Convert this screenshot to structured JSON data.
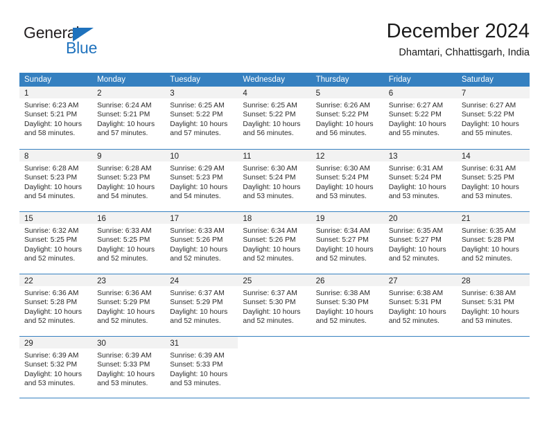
{
  "brand": {
    "name_part1": "General",
    "name_part2": "Blue",
    "accent_color": "#1f72bd"
  },
  "header": {
    "title": "December 2024",
    "location": "Dhamtari, Chhattisgarh, India"
  },
  "theme": {
    "header_band": "#3580c0",
    "day_number_band": "#f2f2f2",
    "grid_line": "#3580c0"
  },
  "calendar": {
    "weekday_headers": [
      "Sunday",
      "Monday",
      "Tuesday",
      "Wednesday",
      "Thursday",
      "Friday",
      "Saturday"
    ],
    "labels": {
      "sunrise": "Sunrise:",
      "sunset": "Sunset:",
      "daylight": "Daylight:"
    },
    "weeks": [
      [
        {
          "day": "1",
          "sunrise": "Sunrise: 6:23 AM",
          "sunset": "Sunset: 5:21 PM",
          "daylight_line1": "Daylight: 10 hours",
          "daylight_line2": "and 58 minutes."
        },
        {
          "day": "2",
          "sunrise": "Sunrise: 6:24 AM",
          "sunset": "Sunset: 5:21 PM",
          "daylight_line1": "Daylight: 10 hours",
          "daylight_line2": "and 57 minutes."
        },
        {
          "day": "3",
          "sunrise": "Sunrise: 6:25 AM",
          "sunset": "Sunset: 5:22 PM",
          "daylight_line1": "Daylight: 10 hours",
          "daylight_line2": "and 57 minutes."
        },
        {
          "day": "4",
          "sunrise": "Sunrise: 6:25 AM",
          "sunset": "Sunset: 5:22 PM",
          "daylight_line1": "Daylight: 10 hours",
          "daylight_line2": "and 56 minutes."
        },
        {
          "day": "5",
          "sunrise": "Sunrise: 6:26 AM",
          "sunset": "Sunset: 5:22 PM",
          "daylight_line1": "Daylight: 10 hours",
          "daylight_line2": "and 56 minutes."
        },
        {
          "day": "6",
          "sunrise": "Sunrise: 6:27 AM",
          "sunset": "Sunset: 5:22 PM",
          "daylight_line1": "Daylight: 10 hours",
          "daylight_line2": "and 55 minutes."
        },
        {
          "day": "7",
          "sunrise": "Sunrise: 6:27 AM",
          "sunset": "Sunset: 5:22 PM",
          "daylight_line1": "Daylight: 10 hours",
          "daylight_line2": "and 55 minutes."
        }
      ],
      [
        {
          "day": "8",
          "sunrise": "Sunrise: 6:28 AM",
          "sunset": "Sunset: 5:23 PM",
          "daylight_line1": "Daylight: 10 hours",
          "daylight_line2": "and 54 minutes."
        },
        {
          "day": "9",
          "sunrise": "Sunrise: 6:28 AM",
          "sunset": "Sunset: 5:23 PM",
          "daylight_line1": "Daylight: 10 hours",
          "daylight_line2": "and 54 minutes."
        },
        {
          "day": "10",
          "sunrise": "Sunrise: 6:29 AM",
          "sunset": "Sunset: 5:23 PM",
          "daylight_line1": "Daylight: 10 hours",
          "daylight_line2": "and 54 minutes."
        },
        {
          "day": "11",
          "sunrise": "Sunrise: 6:30 AM",
          "sunset": "Sunset: 5:24 PM",
          "daylight_line1": "Daylight: 10 hours",
          "daylight_line2": "and 53 minutes."
        },
        {
          "day": "12",
          "sunrise": "Sunrise: 6:30 AM",
          "sunset": "Sunset: 5:24 PM",
          "daylight_line1": "Daylight: 10 hours",
          "daylight_line2": "and 53 minutes."
        },
        {
          "day": "13",
          "sunrise": "Sunrise: 6:31 AM",
          "sunset": "Sunset: 5:24 PM",
          "daylight_line1": "Daylight: 10 hours",
          "daylight_line2": "and 53 minutes."
        },
        {
          "day": "14",
          "sunrise": "Sunrise: 6:31 AM",
          "sunset": "Sunset: 5:25 PM",
          "daylight_line1": "Daylight: 10 hours",
          "daylight_line2": "and 53 minutes."
        }
      ],
      [
        {
          "day": "15",
          "sunrise": "Sunrise: 6:32 AM",
          "sunset": "Sunset: 5:25 PM",
          "daylight_line1": "Daylight: 10 hours",
          "daylight_line2": "and 52 minutes."
        },
        {
          "day": "16",
          "sunrise": "Sunrise: 6:33 AM",
          "sunset": "Sunset: 5:25 PM",
          "daylight_line1": "Daylight: 10 hours",
          "daylight_line2": "and 52 minutes."
        },
        {
          "day": "17",
          "sunrise": "Sunrise: 6:33 AM",
          "sunset": "Sunset: 5:26 PM",
          "daylight_line1": "Daylight: 10 hours",
          "daylight_line2": "and 52 minutes."
        },
        {
          "day": "18",
          "sunrise": "Sunrise: 6:34 AM",
          "sunset": "Sunset: 5:26 PM",
          "daylight_line1": "Daylight: 10 hours",
          "daylight_line2": "and 52 minutes."
        },
        {
          "day": "19",
          "sunrise": "Sunrise: 6:34 AM",
          "sunset": "Sunset: 5:27 PM",
          "daylight_line1": "Daylight: 10 hours",
          "daylight_line2": "and 52 minutes."
        },
        {
          "day": "20",
          "sunrise": "Sunrise: 6:35 AM",
          "sunset": "Sunset: 5:27 PM",
          "daylight_line1": "Daylight: 10 hours",
          "daylight_line2": "and 52 minutes."
        },
        {
          "day": "21",
          "sunrise": "Sunrise: 6:35 AM",
          "sunset": "Sunset: 5:28 PM",
          "daylight_line1": "Daylight: 10 hours",
          "daylight_line2": "and 52 minutes."
        }
      ],
      [
        {
          "day": "22",
          "sunrise": "Sunrise: 6:36 AM",
          "sunset": "Sunset: 5:28 PM",
          "daylight_line1": "Daylight: 10 hours",
          "daylight_line2": "and 52 minutes."
        },
        {
          "day": "23",
          "sunrise": "Sunrise: 6:36 AM",
          "sunset": "Sunset: 5:29 PM",
          "daylight_line1": "Daylight: 10 hours",
          "daylight_line2": "and 52 minutes."
        },
        {
          "day": "24",
          "sunrise": "Sunrise: 6:37 AM",
          "sunset": "Sunset: 5:29 PM",
          "daylight_line1": "Daylight: 10 hours",
          "daylight_line2": "and 52 minutes."
        },
        {
          "day": "25",
          "sunrise": "Sunrise: 6:37 AM",
          "sunset": "Sunset: 5:30 PM",
          "daylight_line1": "Daylight: 10 hours",
          "daylight_line2": "and 52 minutes."
        },
        {
          "day": "26",
          "sunrise": "Sunrise: 6:38 AM",
          "sunset": "Sunset: 5:30 PM",
          "daylight_line1": "Daylight: 10 hours",
          "daylight_line2": "and 52 minutes."
        },
        {
          "day": "27",
          "sunrise": "Sunrise: 6:38 AM",
          "sunset": "Sunset: 5:31 PM",
          "daylight_line1": "Daylight: 10 hours",
          "daylight_line2": "and 52 minutes."
        },
        {
          "day": "28",
          "sunrise": "Sunrise: 6:38 AM",
          "sunset": "Sunset: 5:31 PM",
          "daylight_line1": "Daylight: 10 hours",
          "daylight_line2": "and 53 minutes."
        }
      ],
      [
        {
          "day": "29",
          "sunrise": "Sunrise: 6:39 AM",
          "sunset": "Sunset: 5:32 PM",
          "daylight_line1": "Daylight: 10 hours",
          "daylight_line2": "and 53 minutes."
        },
        {
          "day": "30",
          "sunrise": "Sunrise: 6:39 AM",
          "sunset": "Sunset: 5:33 PM",
          "daylight_line1": "Daylight: 10 hours",
          "daylight_line2": "and 53 minutes."
        },
        {
          "day": "31",
          "sunrise": "Sunrise: 6:39 AM",
          "sunset": "Sunset: 5:33 PM",
          "daylight_line1": "Daylight: 10 hours",
          "daylight_line2": "and 53 minutes."
        },
        {
          "day": "",
          "sunrise": "",
          "sunset": "",
          "daylight_line1": "",
          "daylight_line2": ""
        },
        {
          "day": "",
          "sunrise": "",
          "sunset": "",
          "daylight_line1": "",
          "daylight_line2": ""
        },
        {
          "day": "",
          "sunrise": "",
          "sunset": "",
          "daylight_line1": "",
          "daylight_line2": ""
        },
        {
          "day": "",
          "sunrise": "",
          "sunset": "",
          "daylight_line1": "",
          "daylight_line2": ""
        }
      ]
    ]
  }
}
